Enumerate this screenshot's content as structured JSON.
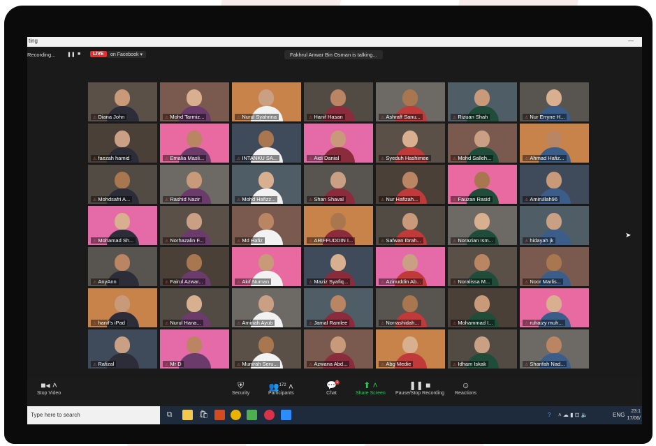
{
  "window": {
    "title": "ting"
  },
  "statusbar": {
    "recording": "Recording...",
    "pause_icon": "pause-icon",
    "stop_icon": "stop-icon",
    "live_badge": "LIVE",
    "stream_target": "on Facebook",
    "talking": "Fakhrul Anwar Bin Osman is talking..."
  },
  "participants": [
    "Diana John",
    "Mohd Tarmiz...",
    "Nurul Syahrina",
    "Hanif Hasan",
    "Ashraff Sanu...",
    "Rizuan Shah",
    "Nur Erryne H...",
    "faezah hamid",
    "Emalia Masli...",
    "INTANKU SA...",
    "Aidi Danial",
    "Syeduh Hashimee",
    "Mohd Salleh...",
    "Ahmad Hafiz...",
    "Mohdsafri A...",
    "Rashid Nazir",
    "Mohd Hafizz...",
    "Shan Shaval",
    "Nur Hafizah...",
    "Fauzan Rasid",
    "Amirullah96",
    "Mohamad Sh...",
    "Norhazalin F...",
    "Md Hafiz",
    "ARIFFUDDIN I...",
    "Safwan Ibrah...",
    "Norazian Ism...",
    "hidayah jk",
    "AnyAnn",
    "Fairul Azwar...",
    "Akif Numan",
    "Maziz Syafiq...",
    "Azinuddin Ab...",
    "Noralissa M...",
    "Noor Marlis...",
    "hanif's iPad",
    "Nurul Hana...",
    "Aminah Ayub",
    "Jamal Ramlee",
    "Norrashidah...",
    "Mohammad I...",
    "ruhaizy muh...",
    "Rafizal",
    "Mr D",
    "Munirah Seru...",
    "Azwana Abd...",
    "Abg Medie",
    "Idham Iskak",
    "Sharifah Nad..."
  ],
  "toolbar": {
    "stop_video": "Stop Video",
    "security": "Security",
    "participants": "Participants",
    "participants_count": "172",
    "chat": "Chat",
    "chat_badge": "1",
    "share_screen": "Share Screen",
    "pause_recording": "Pause/Stop Recording",
    "reactions": "Reactions"
  },
  "taskbar": {
    "search_placeholder": "Type here to search",
    "language": "ENG",
    "time": "23:1",
    "date": "17/06/"
  },
  "colors": {
    "live_red": "#e0302f",
    "share_green": "#2fc55b",
    "toolbar_bg": "#1b1b1b",
    "taskbar_bg": "#1d2b3c"
  }
}
